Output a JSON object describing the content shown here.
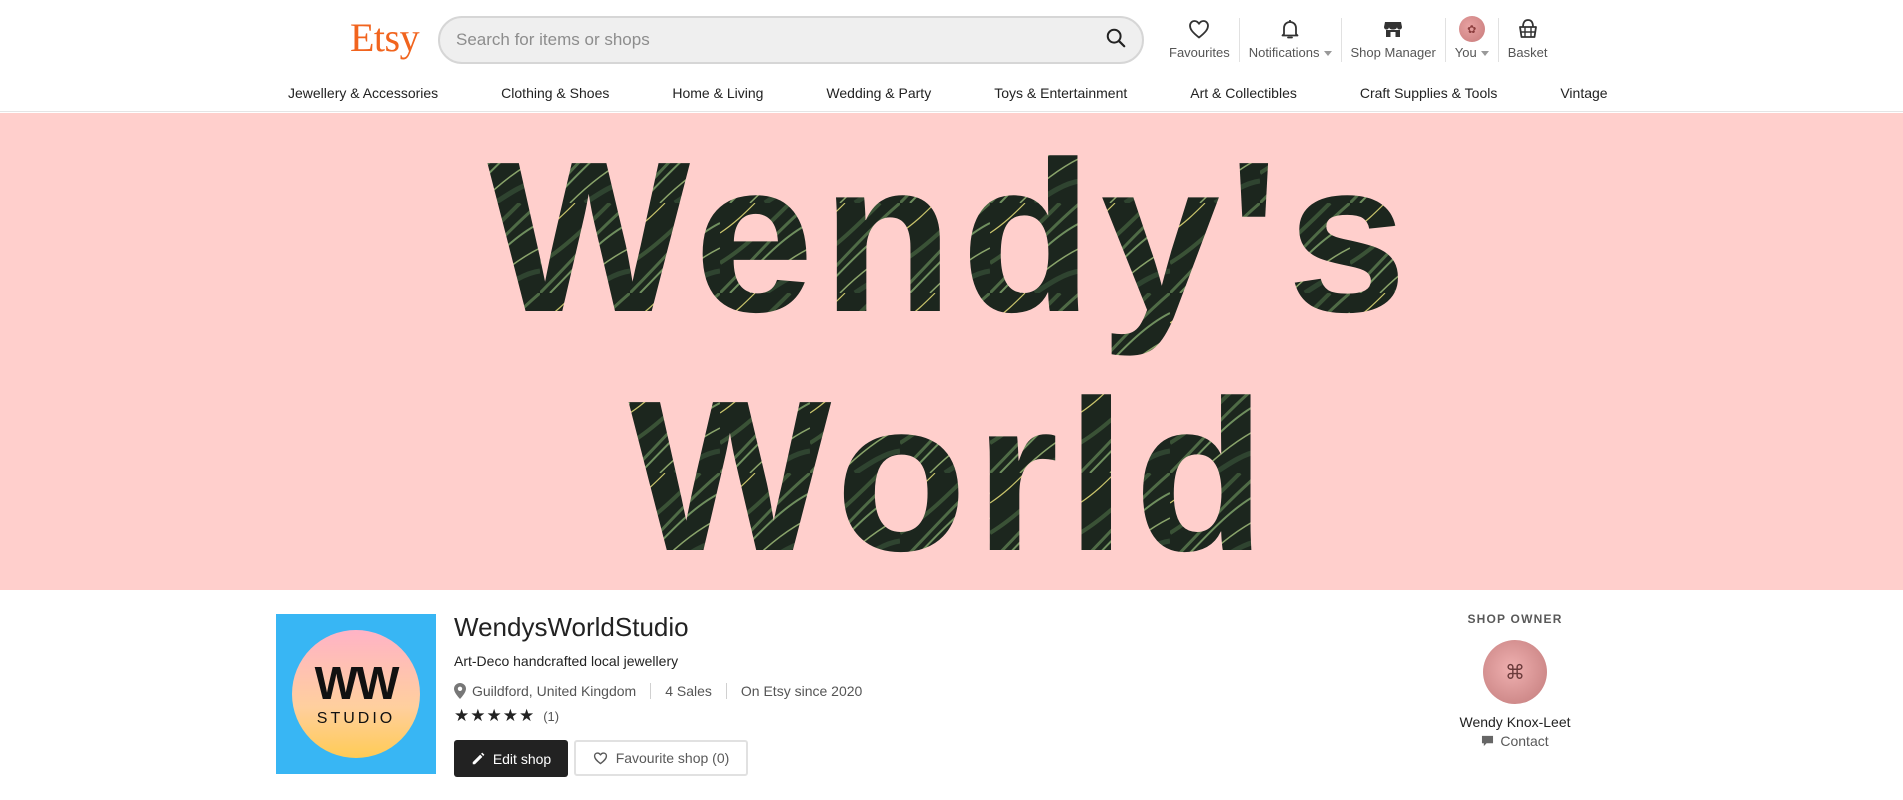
{
  "header": {
    "logo": "Etsy",
    "search_placeholder": "Search for items or shops",
    "nav": {
      "favourites": "Favourites",
      "notifications": "Notifications",
      "shop_manager": "Shop Manager",
      "you": "You",
      "basket": "Basket"
    }
  },
  "categories": [
    "Jewellery & Accessories",
    "Clothing & Shoes",
    "Home & Living",
    "Wedding & Party",
    "Toys & Entertainment",
    "Art & Collectibles",
    "Craft Supplies & Tools",
    "Vintage"
  ],
  "banner": {
    "line1": "Wendy's",
    "line2": "World",
    "background_color": "#ffcfcc",
    "text_fill_color": "#1f2b22"
  },
  "shop": {
    "logo_ww": "WW",
    "logo_studio": "STUDIO",
    "logo_bg_color": "#38b6f4",
    "name": "WendysWorldStudio",
    "tagline": "Art-Deco handcrafted local jewellery",
    "location": "Guildford, United Kingdom",
    "sales": "4 Sales",
    "since": "On Etsy since 2020",
    "stars": "★★★★★",
    "rating_count": "(1)",
    "edit_button": "Edit shop",
    "favourite_button": "Favourite shop (0)"
  },
  "owner": {
    "heading": "SHOP OWNER",
    "name": "Wendy Knox-Leet",
    "contact": "Contact"
  },
  "colors": {
    "brand_orange": "#F1641E",
    "dark_button": "#222222"
  },
  "icons": {
    "search": "search-icon",
    "favourites": "heart-icon",
    "notifications": "bell-icon",
    "shop_manager": "shop-icon",
    "basket": "basket-icon",
    "location": "pin-icon",
    "edit": "pencil-icon",
    "contact": "message-icon"
  }
}
